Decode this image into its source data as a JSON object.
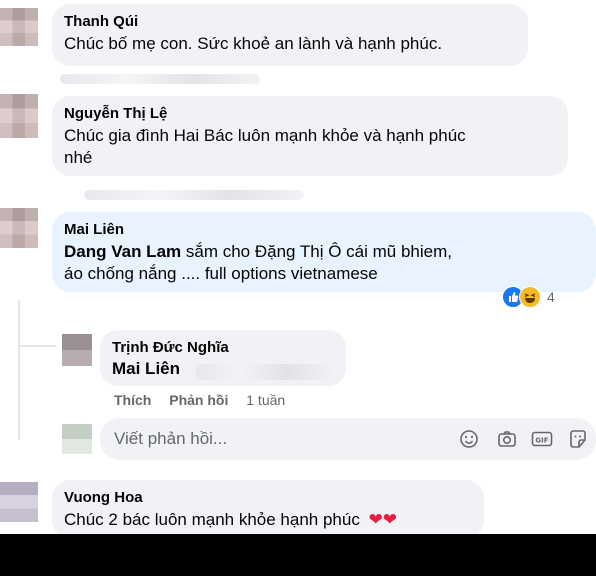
{
  "comments": [
    {
      "author": "Thanh Qúi",
      "text": "Chúc bố mẹ con. Sức khoẻ an lành và hạnh phúc."
    },
    {
      "author": "Nguyễn Thị Lệ",
      "text_line1": "Chúc gia đình Hai Bác luôn mạnh khỏe và hạnh phúc",
      "text_line2": "nhé"
    },
    {
      "author": "Mai Liên",
      "mention": "Dang Van Lam",
      "text_line1_rest": " sắm cho Đặng Thị Ô cái mũ bhiem,",
      "text_line2": "áo chống nắng .... full options vietnamese",
      "reaction_count": "4",
      "reactions": [
        "like-icon",
        "haha-icon"
      ],
      "reply": {
        "author": "Trịnh Đức Nghĩa",
        "mention": "Mai Liên",
        "actions": {
          "like": "Thích",
          "reply": "Phản hồi",
          "time": "1 tuần"
        }
      },
      "reply_box": {
        "placeholder": "Viết phản hồi...",
        "tools": [
          "emoji-icon",
          "camera-icon",
          "gif-icon",
          "sticker-icon"
        ]
      }
    },
    {
      "author": "Vuong Hoa",
      "text": "Chúc 2 bác luôn mạnh khỏe hạnh phúc",
      "emoji": "❤❤"
    }
  ],
  "colors": {
    "bubble": "#f0f2f5",
    "bubble_highlight": "#e7f3ff",
    "meta_text": "#65676b",
    "like_blue": "#1877f2",
    "haha_yellow": "#f7b928",
    "heart_red": "#e41e3f"
  }
}
